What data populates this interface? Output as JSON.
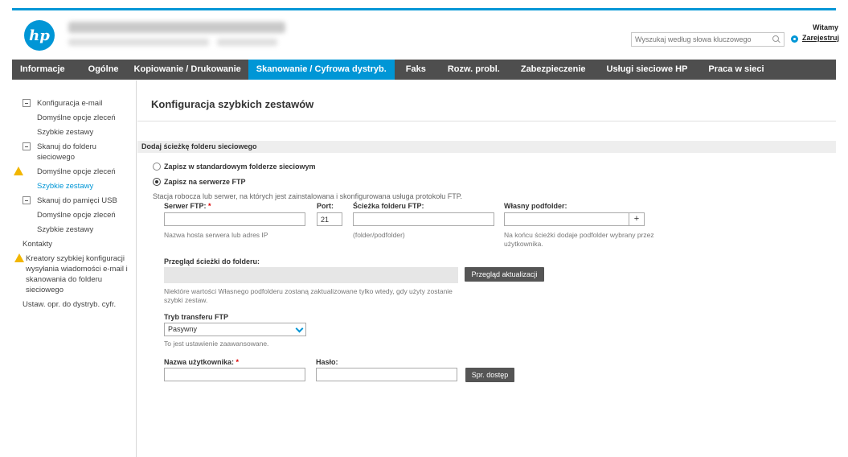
{
  "header": {
    "logo_text": "hp",
    "welcome": "Witamy",
    "search_placeholder": "Wyszukaj według słowa kluczowego",
    "signin": "Zarejestruj"
  },
  "nav": {
    "tabs": [
      {
        "label": "Informacje"
      },
      {
        "label": "Ogólne"
      },
      {
        "label": "Kopiowanie / Drukowanie"
      },
      {
        "label": "Skanowanie / Cyfrowa dystryb.",
        "active": true
      },
      {
        "label": "Faks"
      },
      {
        "label": "Rozw. probl."
      },
      {
        "label": "Zabezpieczenie"
      },
      {
        "label": "Usługi sieciowe HP"
      },
      {
        "label": "Praca w sieci"
      }
    ]
  },
  "sidebar": {
    "items": [
      {
        "label": "Konfiguracja e-mail"
      },
      {
        "label": "Domyślne opcje zleceń"
      },
      {
        "label": "Szybkie zestawy"
      },
      {
        "label": "Skanuj do folderu sieciowego"
      },
      {
        "label": "Domyślne opcje zleceń"
      },
      {
        "label": "Szybkie zestawy"
      },
      {
        "label": "Skanuj do pamięci USB"
      },
      {
        "label": "Domyślne opcje zleceń"
      },
      {
        "label": "Szybkie zestawy"
      },
      {
        "label": "Kontakty"
      },
      {
        "label": "Kreatory szybkiej konfiguracji wysyłania wiadomości e-mail i skanowania do folderu sieciowego"
      },
      {
        "label": "Ustaw. opr. do dystryb. cyfr."
      }
    ]
  },
  "main": {
    "title": "Konfiguracja szybkich zestawów",
    "section_header": "Dodaj ścieżkę folderu sieciowego",
    "radio_standard": "Zapisz w standardowym folderze sieciowym",
    "radio_ftp": "Zapisz na serwerze FTP",
    "ftp_desc": "Stacja robocza lub serwer, na których jest zainstalowana i skonfigurowana usługa protokołu FTP.",
    "server_label": "Serwer FTP:",
    "required_mark": "*",
    "port_label": "Port:",
    "port_value": "21",
    "path_label": "Ścieżka folderu FTP:",
    "subfolder_label": "Własny podfolder:",
    "plus": "+",
    "server_help": "Nazwa hosta serwera lub adres IP",
    "path_help": "(folder/podfolder)",
    "subfolder_help": "Na końcu ścieżki dodaje podfolder wybrany przez użytkownika.",
    "preview_label": "Przegląd ścieżki do folderu:",
    "preview_button": "Przegląd aktualizacji",
    "preview_help": "Niektóre wartości Własnego podfolderu zostaną zaktualizowane tylko wtedy, gdy użyty zostanie szybki zestaw.",
    "transfer_label": "Tryb transferu FTP",
    "transfer_value": "Pasywny",
    "transfer_help": "To jest ustawienie zaawansowane.",
    "username_label": "Nazwa użytkownika:",
    "password_label": "Hasło:",
    "check_access_button": "Spr. dostęp"
  },
  "colors": {
    "accent": "#0096d6",
    "nav_bg": "#4e4e4e",
    "warning": "#f2b600"
  }
}
